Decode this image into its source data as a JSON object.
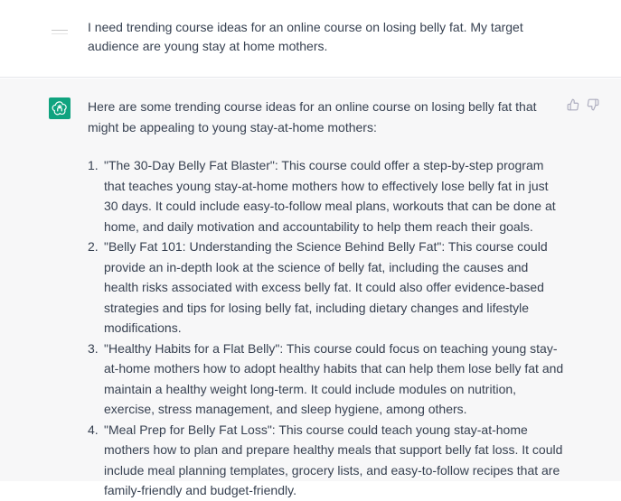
{
  "user_message": {
    "avatar_icon": "user-avatar-icon",
    "text": "I need trending course ideas for an online course on losing belly fat. My target audience are young stay at home mothers."
  },
  "assistant_message": {
    "avatar_icon": "openai-logo-icon",
    "avatar_color": "#10a37f",
    "intro": "Here are some trending course ideas for an online course on losing belly fat that might be appealing to young stay-at-home mothers:",
    "items": [
      {
        "number": "1.",
        "text": "\"The 30-Day Belly Fat Blaster\": This course could offer a step-by-step program that teaches young stay-at-home mothers how to effectively lose belly fat in just 30 days. It could include easy-to-follow meal plans, workouts that can be done at home, and daily motivation and accountability to help them reach their goals."
      },
      {
        "number": "2.",
        "text": "\"Belly Fat 101: Understanding the Science Behind Belly Fat\": This course could provide an in-depth look at the science of belly fat, including the causes and health risks associated with excess belly fat. It could also offer evidence-based strategies and tips for losing belly fat, including dietary changes and lifestyle modifications."
      },
      {
        "number": "3.",
        "text": "\"Healthy Habits for a Flat Belly\": This course could focus on teaching young stay-at-home mothers how to adopt healthy habits that can help them lose belly fat and maintain a healthy weight long-term. It could include modules on nutrition, exercise, stress management, and sleep hygiene, among others."
      },
      {
        "number": "4.",
        "text": "\"Meal Prep for Belly Fat Loss\": This course could teach young stay-at-home mothers how to plan and prepare healthy meals that support belly fat loss. It could include meal planning templates, grocery lists, and easy-to-follow recipes that are family-friendly and budget-friendly."
      }
    ],
    "feedback": {
      "thumbs_up_icon": "thumbs-up-icon",
      "thumbs_down_icon": "thumbs-down-icon"
    }
  },
  "colors": {
    "assistant_background": "#f7f7f8",
    "text": "#374151",
    "icon": "#acacbe"
  }
}
